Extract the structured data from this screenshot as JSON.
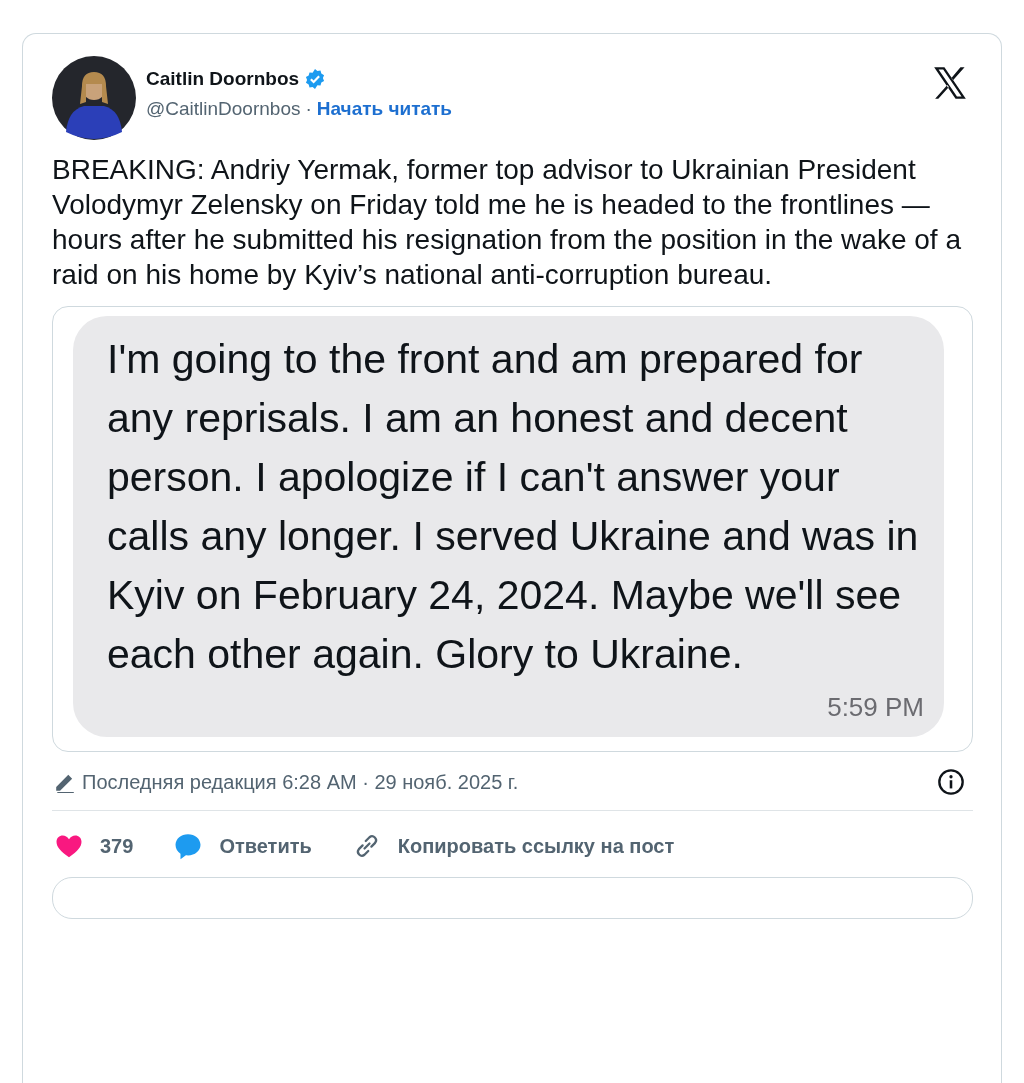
{
  "author": {
    "name": "Caitlin Doornbos",
    "verified": true,
    "handle": "@CaitlinDoornbos",
    "separator": "·",
    "follow": "Начать читать"
  },
  "body": "BREAKING: Andriy Yermak, former top advisor to Ukrainian President Volodymyr Zelensky on Friday told me he is headed to the frontlines — hours after he submitted his resignation from the position in the wake of a raid on his home by Kyiv’s national anti-corruption bureau.",
  "media": {
    "message": "I'm going to the front and am prepared for any reprisals. I am an honest and decent person. I apologize if I can't answer your calls any longer. I served Ukraine and was in Kyiv on February 24, 2024. Maybe we'll see each other again. Glory to Ukraine.",
    "time": "5:59 PM"
  },
  "edited": "Последняя редакция 6:28 AM · 29 нояб. 2025 г.",
  "actions": [
    {
      "kind": "like",
      "label": "379",
      "selected": true
    },
    {
      "kind": "reply",
      "label": "Ответить"
    },
    {
      "kind": "link",
      "label": "Копировать ссылку на пост"
    }
  ]
}
